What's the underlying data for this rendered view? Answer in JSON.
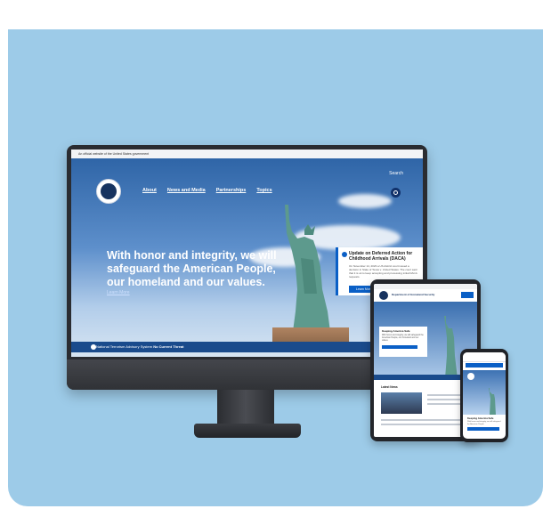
{
  "desktop": {
    "gov_banner": "An official website of the United States government",
    "search_link": "Search",
    "nav": [
      "About",
      "News and Media",
      "Partnerships",
      "Topics"
    ],
    "headline": "With honor and integrity, we will safeguard the American People, our homeland and our values.",
    "learn_more": "Learn More",
    "alert": {
      "title": "Update on Deferred Action for Childhood Arrivals (DACA)",
      "body": "On November 14, 2023 a US district court issued a decision in State of Texas v. United States. The court said that it is ok to keep accepting and processing initial DACA requests.",
      "button": "Learn More"
    },
    "threat_text": "National Terrorism Advisory System",
    "threat_status": "No Current Threat"
  },
  "tablet": {
    "site_name": "Department of Homeland Security",
    "card_title": "Keeping America Safe",
    "card_body": "With honor and integrity, we will safeguard the American People, our homeland and our values.",
    "news_title": "Latest News"
  },
  "phone": {
    "card_title": "Keeping America Safe",
    "card_body": "With honor and integrity, we will safeguard the American People."
  },
  "colors": {
    "background": "#9dcbe8",
    "accent": "#0a5fc6",
    "navy": "#17335f"
  }
}
